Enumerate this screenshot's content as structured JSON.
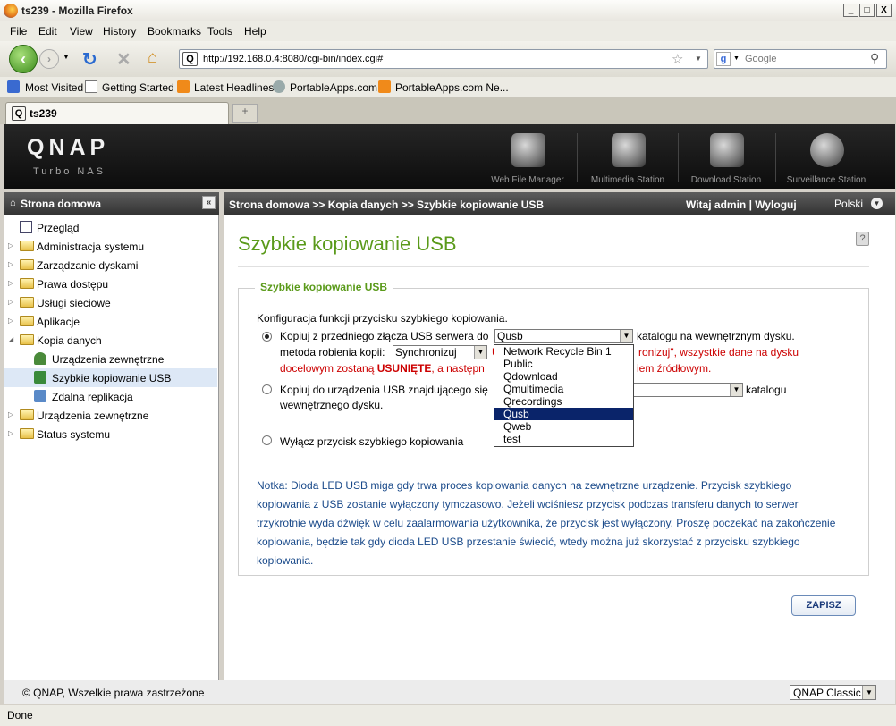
{
  "window": {
    "title": "ts239 - Mozilla Firefox",
    "min": "_",
    "max": "□",
    "close": "X"
  },
  "menu": [
    "File",
    "Edit",
    "View",
    "History",
    "Bookmarks",
    "Tools",
    "Help"
  ],
  "nav": {
    "url": "http://192.168.0.4:8080/cgi-bin/index.cgi#",
    "search_placeholder": "Google"
  },
  "bookmarks": [
    "Most Visited",
    "Getting Started",
    "Latest Headlines",
    "PortableApps.com",
    "PortableApps.com Ne..."
  ],
  "tab": {
    "label": "ts239"
  },
  "qnap": {
    "logo": "QNAP",
    "subtitle": "Turbo NAS",
    "apps": [
      "Web File Manager",
      "Multimedia Station",
      "Download Station",
      "Surveillance Station"
    ]
  },
  "sidebar": {
    "title": "Strona domowa",
    "items": [
      {
        "label": "Przegląd"
      },
      {
        "label": "Administracja systemu"
      },
      {
        "label": "Zarządzanie dyskami"
      },
      {
        "label": "Prawa dostępu"
      },
      {
        "label": "Usługi sieciowe"
      },
      {
        "label": "Aplikacje"
      },
      {
        "label": "Kopia danych"
      },
      {
        "label": "Urządzenia zewnętrzne"
      },
      {
        "label": "Szybkie kopiowanie USB"
      },
      {
        "label": "Zdalna replikacja"
      },
      {
        "label": "Urządzenia zewnętrzne"
      },
      {
        "label": "Status systemu"
      }
    ]
  },
  "header": {
    "breadcrumb": "Strona domowa >> Kopia danych >> Szybkie kopiowanie USB",
    "welcome": "Witaj admin | Wyloguj",
    "language": "Polski"
  },
  "main": {
    "title": "Szybkie kopiowanie USB",
    "help": "?",
    "legend": "Szybkie kopiowanie USB",
    "intro": "Konfiguracja funkcji przycisku szybkiego kopiowania.",
    "opt1_label": "Kopiuj z przedniego złącza USB serwera do",
    "opt1_select": "Qusb",
    "opt1_suffix": "katalogu na wewnętrznym dysku.",
    "method_label": "metoda robienia kopii:",
    "method_value": "Synchronizuj",
    "warn_line1_a": "U",
    "warn_line1_b": "ronizuj\", wszystkie dane na dysku",
    "warn_line2_a": "docelowym zostaną ",
    "warn_line2_bold": "USUNIĘTE",
    "warn_line2_b": ", a następn",
    "warn_line2_c": "iem źródłowym.",
    "opt2_label": "Kopiuj do urządzenia USB znajdującego się",
    "opt2_suffix": "katalogu",
    "opt2_line2": "wewnętrznego dysku.",
    "opt3_label": "Wyłącz przycisk szybkiego kopiowania",
    "note": "Notka: Dioda LED USB miga gdy trwa proces kopiowania danych na zewnętrzne urządzenie. Przycisk szybkiego kopiowania z USB zostanie wyłączony tymczasowo. Jeżeli wciśniesz przycisk podczas transferu danych to serwer trzykrotnie wyda dźwięk w celu zaalarmowania użytkownika, że przycisk jest wyłączony. Proszę poczekać na zakończenie kopiowania, będzie tak gdy dioda LED USB przestanie świecić, wtedy można już skorzystać z przycisku szybkiego kopiowania.",
    "save": "ZAPISZ",
    "dropdown_options": [
      "Network Recycle Bin 1",
      "Public",
      "Qdownload",
      "Qmultimedia",
      "Qrecordings",
      "Qusb",
      "Qweb",
      "test"
    ],
    "dropdown_selected": "Qusb"
  },
  "footer": {
    "copyright": "© QNAP, Wszelkie prawa zastrzeżone",
    "style": "QNAP Classic"
  },
  "status": "Done"
}
